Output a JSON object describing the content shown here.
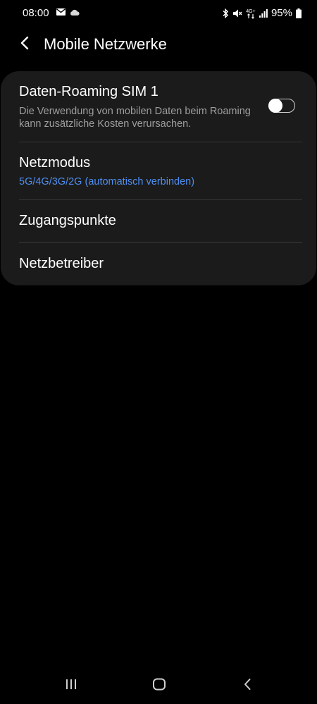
{
  "status_bar": {
    "time": "08:00",
    "battery": "95%",
    "network_label": "4G+",
    "icons": [
      "mail-icon",
      "cloud-icon",
      "bluetooth-icon",
      "mute-icon",
      "network-4g-icon",
      "signal-icon",
      "battery-icon"
    ]
  },
  "header": {
    "title": "Mobile Netzwerke",
    "back_icon": "back-arrow-icon"
  },
  "settings": {
    "data_roaming": {
      "title": "Daten-Roaming SIM 1",
      "description": "Die Verwendung von mobilen Daten beim Roaming kann zusätzliche Kosten verursachen.",
      "enabled": false
    },
    "network_mode": {
      "title": "Netzmodus",
      "value": "5G/4G/3G/2G (automatisch verbinden)"
    },
    "access_points": {
      "title": "Zugangspunkte"
    },
    "network_operators": {
      "title": "Netzbetreiber"
    }
  },
  "nav_bar": {
    "icons": [
      "recent-apps-icon",
      "home-icon",
      "back-icon"
    ]
  },
  "colors": {
    "background": "#000000",
    "card": "#1b1b1b",
    "accent": "#4f8ef0",
    "secondary_text": "#9e9e9e"
  }
}
